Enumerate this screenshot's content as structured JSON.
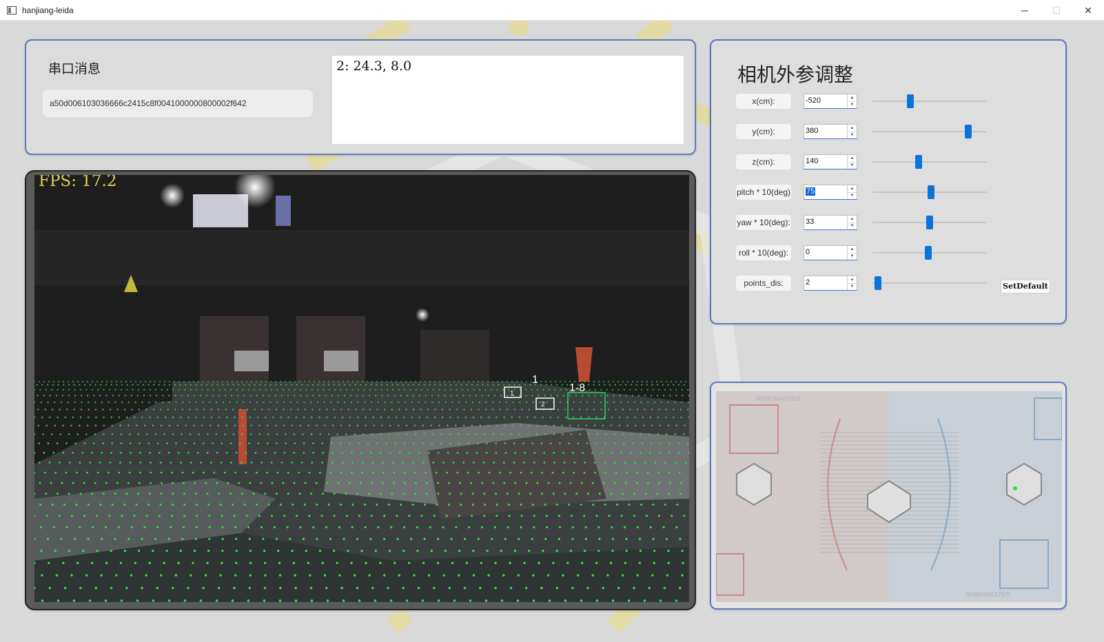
{
  "window": {
    "title": "hanjiang-leida",
    "controls": {
      "minimize": "─",
      "maximize": "☐",
      "close": "✕"
    }
  },
  "serial": {
    "title": "串口消息",
    "message": "a50d006103036666c2415c8f0041000000800002f642",
    "output": "2: 24.3, 8.0"
  },
  "camera": {
    "fps_text": "FPS: 17.2",
    "robot_labels": [
      "1",
      "1",
      "2",
      "1-8"
    ]
  },
  "extrinsic": {
    "title": "相机外参调整",
    "params": [
      {
        "label": "x(cm):",
        "value": "-520",
        "slider_fraction": 0.32
      },
      {
        "label": "y(cm):",
        "value": "380",
        "slider_fraction": 0.86
      },
      {
        "label": "z(cm):",
        "value": "140",
        "slider_fraction": 0.4
      },
      {
        "label": "pitch * 10(deg)",
        "value": "75",
        "slider_fraction": 0.51
      },
      {
        "label": "yaw * 10(deg):",
        "value": "33",
        "slider_fraction": 0.5
      },
      {
        "label": "roll * 10(deg):",
        "value": "0",
        "slider_fraction": 0.49
      },
      {
        "label": "points_dis:",
        "value": "2",
        "slider_fraction": 0.02
      }
    ],
    "setdefault_label": "SetDefault"
  },
  "map": {
    "brand_text": "ROBOMASTER"
  },
  "colors": {
    "panel_border": "#5b7bb6",
    "accent": "#0a74da",
    "point_green": "#2fe23a",
    "fps_yellow": "#e6d44c"
  }
}
